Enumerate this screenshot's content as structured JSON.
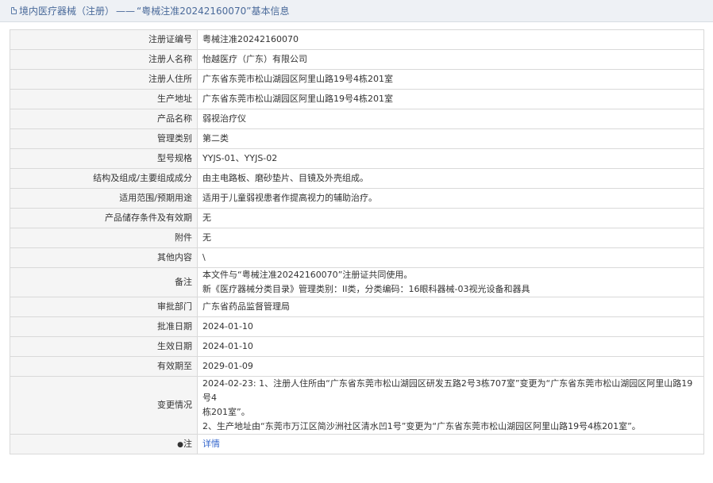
{
  "header": {
    "prefix": "境内医疗器械（注册）",
    "sep": "——",
    "quote_title": "“粤械注准20242160070”",
    "suffix": "基本信息"
  },
  "rows": [
    {
      "label": "注册证编号",
      "value": "粤械注准20242160070"
    },
    {
      "label": "注册人名称",
      "value": "怡越医疗（广东）有限公司"
    },
    {
      "label": "注册人住所",
      "value": "广东省东莞市松山湖园区阿里山路19号4栋201室"
    },
    {
      "label": "生产地址",
      "value": "广东省东莞市松山湖园区阿里山路19号4栋201室"
    },
    {
      "label": "产品名称",
      "value": "弱视治疗仪"
    },
    {
      "label": "管理类别",
      "value": "第二类"
    },
    {
      "label": "型号规格",
      "value": "YYJS-01、YYJS-02"
    },
    {
      "label": "结构及组成/主要组成成分",
      "value": "由主电路板、磨砂垫片、目镜及外壳组成。"
    },
    {
      "label": "适用范围/预期用途",
      "value": "适用于儿童弱视患者作提高视力的辅助治疗。"
    },
    {
      "label": "产品储存条件及有效期",
      "value": "无"
    },
    {
      "label": "附件",
      "value": "无"
    },
    {
      "label": "其他内容",
      "value": "\\"
    }
  ],
  "notes": {
    "label": "备注",
    "line1": "本文件与“粤械注准20242160070”注册证共同使用。",
    "line2": "新《医疗器械分类目录》管理类别：II类，分类编码：16眼科器械-03视光设备和器具"
  },
  "rows2": [
    {
      "label": "审批部门",
      "value": "广东省药品监督管理局"
    },
    {
      "label": "批准日期",
      "value": "2024-01-10"
    },
    {
      "label": "生效日期",
      "value": "2024-01-10"
    },
    {
      "label": "有效期至",
      "value": "2029-01-09"
    }
  ],
  "changes": {
    "label": "变更情况",
    "line1": "2024-02-23: 1、注册人住所由“广东省东莞市松山湖园区研发五路2号3栋707室”变更为“广东省东莞市松山湖园区阿里山路19号4",
    "line2": "栋201室”。",
    "line3": "2、生产地址由“东莞市万江区简沙洲社区清水凹1号”变更为“广东省东莞市松山湖园区阿里山路19号4栋201室”。"
  },
  "footer_row": {
    "dot": "●",
    "label": "注",
    "link": "详情"
  }
}
